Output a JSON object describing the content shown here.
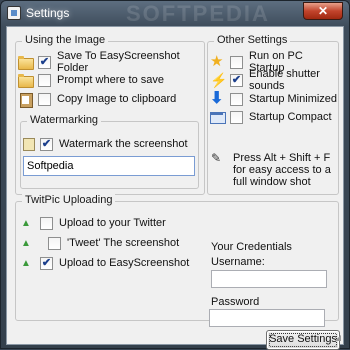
{
  "window": {
    "title": "Settings",
    "close_label": "✕",
    "watermark": "SOFTPEDIA"
  },
  "image_group": {
    "legend": "Using the Image",
    "items": [
      {
        "label": "Save To EasyScreenshot Folder",
        "checked": true,
        "icon": "folder-icon"
      },
      {
        "label": "Prompt where to save",
        "checked": false,
        "icon": "folder-icon"
      },
      {
        "label": "Copy Image to clipboard",
        "checked": false,
        "icon": "clipboard-icon"
      }
    ]
  },
  "watermark_group": {
    "legend": "Watermarking",
    "checkbox_label": "Watermark the screenshot",
    "checked": true,
    "text_value": "Softpedia"
  },
  "other_group": {
    "legend": "Other Settings",
    "items": [
      {
        "label": "Run on PC Startup",
        "checked": false,
        "icon": "star-icon"
      },
      {
        "label": "Enable shutter sounds",
        "checked": true,
        "icon": "lightning-icon"
      },
      {
        "label": "Startup Minimized",
        "checked": false,
        "icon": "down-arrow-icon"
      },
      {
        "label": "Startup Compact",
        "checked": false,
        "icon": "compact-window-icon"
      }
    ],
    "hint": "Press Alt + Shift + F for easy access to a full window shot",
    "hint_icon": "pen-icon"
  },
  "twitpic_group": {
    "legend": "TwitPic Uploading",
    "items": [
      {
        "label": "Upload to your Twitter",
        "checked": false,
        "icon": "green-arrow-icon"
      },
      {
        "label": "'Tweet' The screenshot",
        "checked": false,
        "icon": "green-arrow-icon"
      },
      {
        "label": "Upload to EasyScreenshot",
        "checked": true,
        "icon": "green-arrow-icon"
      }
    ]
  },
  "credentials": {
    "heading": "Your Credentials",
    "username_label": "Username:",
    "username_value": "",
    "password_label": "Password",
    "password_value": ""
  },
  "footer": {
    "save_label": "Save Settings"
  },
  "colors": {
    "check_mark": "#1c3f8c",
    "green_arrow": "#3b9a3b",
    "title_bar": "#3e4c5b"
  }
}
